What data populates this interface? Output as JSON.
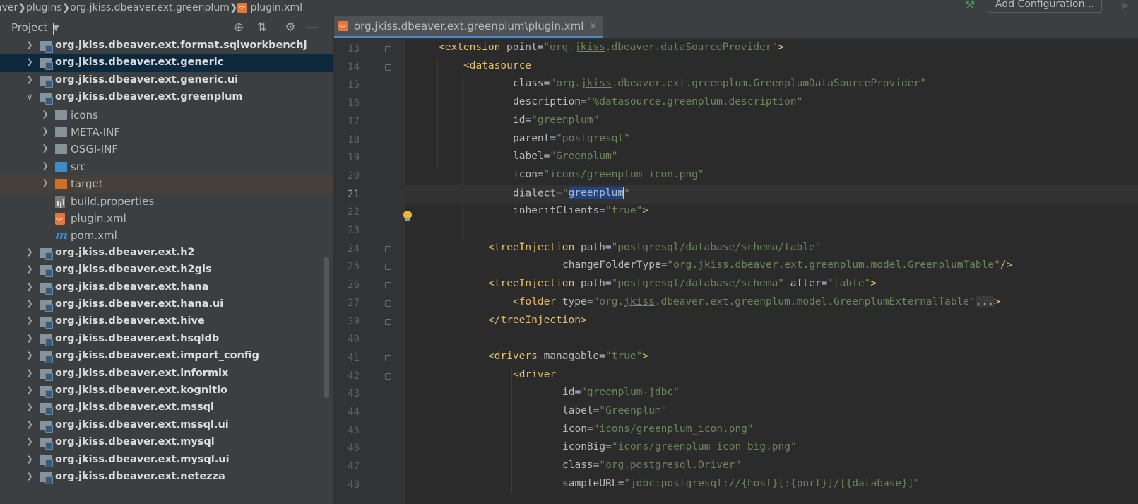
{
  "breadcrumb": {
    "items": [
      "aver",
      "plugins",
      "org.jkiss.dbeaver.ext.greenplum",
      "plugin.xml"
    ]
  },
  "toolbar": {
    "add_configuration": "Add Configuration..."
  },
  "project": {
    "title": "Project"
  },
  "tree": [
    {
      "label": "org.jkiss.dbeaver.ext.format.sqlworkbenchj",
      "type": "module",
      "depth": 0,
      "arrow": "right"
    },
    {
      "label": "org.jkiss.dbeaver.ext.generic",
      "type": "module",
      "depth": 0,
      "arrow": "right",
      "selected": true
    },
    {
      "label": "org.jkiss.dbeaver.ext.generic.ui",
      "type": "module",
      "depth": 0,
      "arrow": "right"
    },
    {
      "label": "org.jkiss.dbeaver.ext.greenplum",
      "type": "module",
      "depth": 0,
      "arrow": "down"
    },
    {
      "label": "icons",
      "type": "folder",
      "depth": 1,
      "arrow": "right"
    },
    {
      "label": "META-INF",
      "type": "folder",
      "depth": 1,
      "arrow": "right"
    },
    {
      "label": "OSGI-INF",
      "type": "folder",
      "depth": 1,
      "arrow": "right"
    },
    {
      "label": "src",
      "type": "src",
      "depth": 1,
      "arrow": "right"
    },
    {
      "label": "target",
      "type": "target",
      "depth": 1,
      "arrow": "right",
      "highlighted": true
    },
    {
      "label": "build.properties",
      "type": "properties",
      "depth": 1,
      "arrow": ""
    },
    {
      "label": "plugin.xml",
      "type": "xml",
      "depth": 1,
      "arrow": ""
    },
    {
      "label": "pom.xml",
      "type": "pom",
      "depth": 1,
      "arrow": ""
    },
    {
      "label": "org.jkiss.dbeaver.ext.h2",
      "type": "module",
      "depth": 0,
      "arrow": "right"
    },
    {
      "label": "org.jkiss.dbeaver.ext.h2gis",
      "type": "module",
      "depth": 0,
      "arrow": "right"
    },
    {
      "label": "org.jkiss.dbeaver.ext.hana",
      "type": "module",
      "depth": 0,
      "arrow": "right"
    },
    {
      "label": "org.jkiss.dbeaver.ext.hana.ui",
      "type": "module",
      "depth": 0,
      "arrow": "right"
    },
    {
      "label": "org.jkiss.dbeaver.ext.hive",
      "type": "module",
      "depth": 0,
      "arrow": "right"
    },
    {
      "label": "org.jkiss.dbeaver.ext.hsqldb",
      "type": "module",
      "depth": 0,
      "arrow": "right"
    },
    {
      "label": "org.jkiss.dbeaver.ext.import_config",
      "type": "module",
      "depth": 0,
      "arrow": "right"
    },
    {
      "label": "org.jkiss.dbeaver.ext.informix",
      "type": "module",
      "depth": 0,
      "arrow": "right"
    },
    {
      "label": "org.jkiss.dbeaver.ext.kognitio",
      "type": "module",
      "depth": 0,
      "arrow": "right"
    },
    {
      "label": "org.jkiss.dbeaver.ext.mssql",
      "type": "module",
      "depth": 0,
      "arrow": "right"
    },
    {
      "label": "org.jkiss.dbeaver.ext.mssql.ui",
      "type": "module",
      "depth": 0,
      "arrow": "right"
    },
    {
      "label": "org.jkiss.dbeaver.ext.mysql",
      "type": "module",
      "depth": 0,
      "arrow": "right"
    },
    {
      "label": "org.jkiss.dbeaver.ext.mysql.ui",
      "type": "module",
      "depth": 0,
      "arrow": "right"
    },
    {
      "label": "org.jkiss.dbeaver.ext.netezza",
      "type": "module",
      "depth": 0,
      "arrow": "right"
    }
  ],
  "editor": {
    "tab_title": "org.jkiss.dbeaver.ext.greenplum\\plugin.xml",
    "current_line": "21",
    "lines": [
      {
        "n": "13",
        "indent": 1,
        "fold": true,
        "tokens": [
          [
            "tg",
            "<extension "
          ],
          [
            "at",
            "point"
          ],
          [
            "p",
            "="
          ],
          [
            "vl",
            "\"org."
          ],
          [
            "vlu",
            "jkiss"
          ],
          [
            "vl",
            ".dbeaver.dataSourceProvider\""
          ],
          [
            "tg",
            ">"
          ]
        ]
      },
      {
        "n": "14",
        "indent": 2,
        "fold": true,
        "tokens": [
          [
            "tg",
            "<datasource"
          ]
        ]
      },
      {
        "n": "15",
        "indent": 4,
        "tokens": [
          [
            "at",
            "class"
          ],
          [
            "p",
            "="
          ],
          [
            "vl",
            "\"org."
          ],
          [
            "vlu",
            "jkiss"
          ],
          [
            "vl",
            ".dbeaver.ext.greenplum.GreenplumDataSourceProvider\""
          ]
        ]
      },
      {
        "n": "16",
        "indent": 4,
        "tokens": [
          [
            "at",
            "description"
          ],
          [
            "p",
            "="
          ],
          [
            "vl",
            "\"%datasource.greenplum.description\""
          ]
        ]
      },
      {
        "n": "17",
        "indent": 4,
        "tokens": [
          [
            "at",
            "id"
          ],
          [
            "p",
            "="
          ],
          [
            "vl",
            "\"greenplum\""
          ]
        ]
      },
      {
        "n": "18",
        "indent": 4,
        "tokens": [
          [
            "at",
            "parent"
          ],
          [
            "p",
            "="
          ],
          [
            "vl",
            "\"postgresql\""
          ]
        ]
      },
      {
        "n": "19",
        "indent": 4,
        "tokens": [
          [
            "at",
            "label"
          ],
          [
            "p",
            "="
          ],
          [
            "vl",
            "\"Greenplum\""
          ]
        ]
      },
      {
        "n": "20",
        "indent": 4,
        "tokens": [
          [
            "at",
            "icon"
          ],
          [
            "p",
            "="
          ],
          [
            "vl",
            "\"icons/greenplum_icon.png\""
          ]
        ]
      },
      {
        "n": "21",
        "indent": 4,
        "tokens": [
          [
            "at",
            "dialect"
          ],
          [
            "p",
            "="
          ],
          [
            "vl",
            "\""
          ],
          [
            "sel",
            "greenplum"
          ],
          [
            "caret",
            ""
          ],
          [
            "vl",
            "\""
          ]
        ]
      },
      {
        "n": "22",
        "indent": 4,
        "tokens": [
          [
            "at",
            "inheritClients"
          ],
          [
            "p",
            "="
          ],
          [
            "vl",
            "\"true\""
          ],
          [
            "tg",
            ">"
          ]
        ]
      },
      {
        "n": "23",
        "indent": 0,
        "tokens": []
      },
      {
        "n": "24",
        "indent": 3,
        "fold": true,
        "tokens": [
          [
            "tg",
            "<treeInjection "
          ],
          [
            "at",
            "path"
          ],
          [
            "p",
            "="
          ],
          [
            "vl",
            "\"postgresql/database/schema/table\""
          ]
        ]
      },
      {
        "n": "25",
        "indent": 6,
        "fold": true,
        "tokens": [
          [
            "at",
            "changeFolderType"
          ],
          [
            "p",
            "="
          ],
          [
            "vl",
            "\"org."
          ],
          [
            "vlu",
            "jkiss"
          ],
          [
            "vl",
            ".dbeaver.ext.greenplum.model.GreenplumTable\""
          ],
          [
            "tg",
            "/>"
          ]
        ]
      },
      {
        "n": "26",
        "indent": 3,
        "fold": true,
        "tokens": [
          [
            "tg",
            "<treeInjection "
          ],
          [
            "at",
            "path"
          ],
          [
            "p",
            "="
          ],
          [
            "vl",
            "\"postgresql/database/schema\" "
          ],
          [
            "at",
            "after"
          ],
          [
            "p",
            "="
          ],
          [
            "vl",
            "\"table\""
          ],
          [
            "tg",
            ">"
          ]
        ]
      },
      {
        "n": "27",
        "indent": 4,
        "fold": true,
        "tokens": [
          [
            "tg",
            "<folder "
          ],
          [
            "at",
            "type"
          ],
          [
            "p",
            "="
          ],
          [
            "vl",
            "\"org."
          ],
          [
            "vlu",
            "jkiss"
          ],
          [
            "vl",
            ".dbeaver.ext.greenplum.model.GreenplumExternalTable\""
          ],
          [
            "fd",
            "..."
          ],
          [
            "tg",
            ">"
          ]
        ]
      },
      {
        "n": "39",
        "indent": 3,
        "fold": true,
        "tokens": [
          [
            "tg",
            "</treeInjection>"
          ]
        ]
      },
      {
        "n": "40",
        "indent": 0,
        "tokens": []
      },
      {
        "n": "41",
        "indent": 3,
        "fold": true,
        "tokens": [
          [
            "tg",
            "<drivers "
          ],
          [
            "at",
            "managable"
          ],
          [
            "p",
            "="
          ],
          [
            "vl",
            "\"true\""
          ],
          [
            "tg",
            ">"
          ]
        ]
      },
      {
        "n": "42",
        "indent": 4,
        "fold": true,
        "tokens": [
          [
            "tg",
            "<driver"
          ]
        ]
      },
      {
        "n": "43",
        "indent": 6,
        "tokens": [
          [
            "at",
            "id"
          ],
          [
            "p",
            "="
          ],
          [
            "vl",
            "\"greenplum-jdbc\""
          ]
        ]
      },
      {
        "n": "44",
        "indent": 6,
        "tokens": [
          [
            "at",
            "label"
          ],
          [
            "p",
            "="
          ],
          [
            "vl",
            "\"Greenplum\""
          ]
        ]
      },
      {
        "n": "45",
        "indent": 6,
        "tokens": [
          [
            "at",
            "icon"
          ],
          [
            "p",
            "="
          ],
          [
            "vl",
            "\"icons/greenplum_icon.png\""
          ]
        ]
      },
      {
        "n": "46",
        "indent": 6,
        "tokens": [
          [
            "at",
            "iconBig"
          ],
          [
            "p",
            "="
          ],
          [
            "vl",
            "\"icons/greenplum_icon_big.png\""
          ]
        ]
      },
      {
        "n": "47",
        "indent": 6,
        "tokens": [
          [
            "at",
            "class"
          ],
          [
            "p",
            "="
          ],
          [
            "vl",
            "\"org.postgresql.Driver\""
          ]
        ]
      },
      {
        "n": "48",
        "indent": 6,
        "tokens": [
          [
            "at",
            "sampleURL"
          ],
          [
            "p",
            "="
          ],
          [
            "vl",
            "\"jdbc:postgresql://{host}[:{port}]/[{database}]\""
          ]
        ]
      }
    ]
  },
  "colors": {
    "selection": "#214283",
    "tag": "#e8bf6a",
    "value": "#6a8759",
    "attr": "#bababa"
  }
}
